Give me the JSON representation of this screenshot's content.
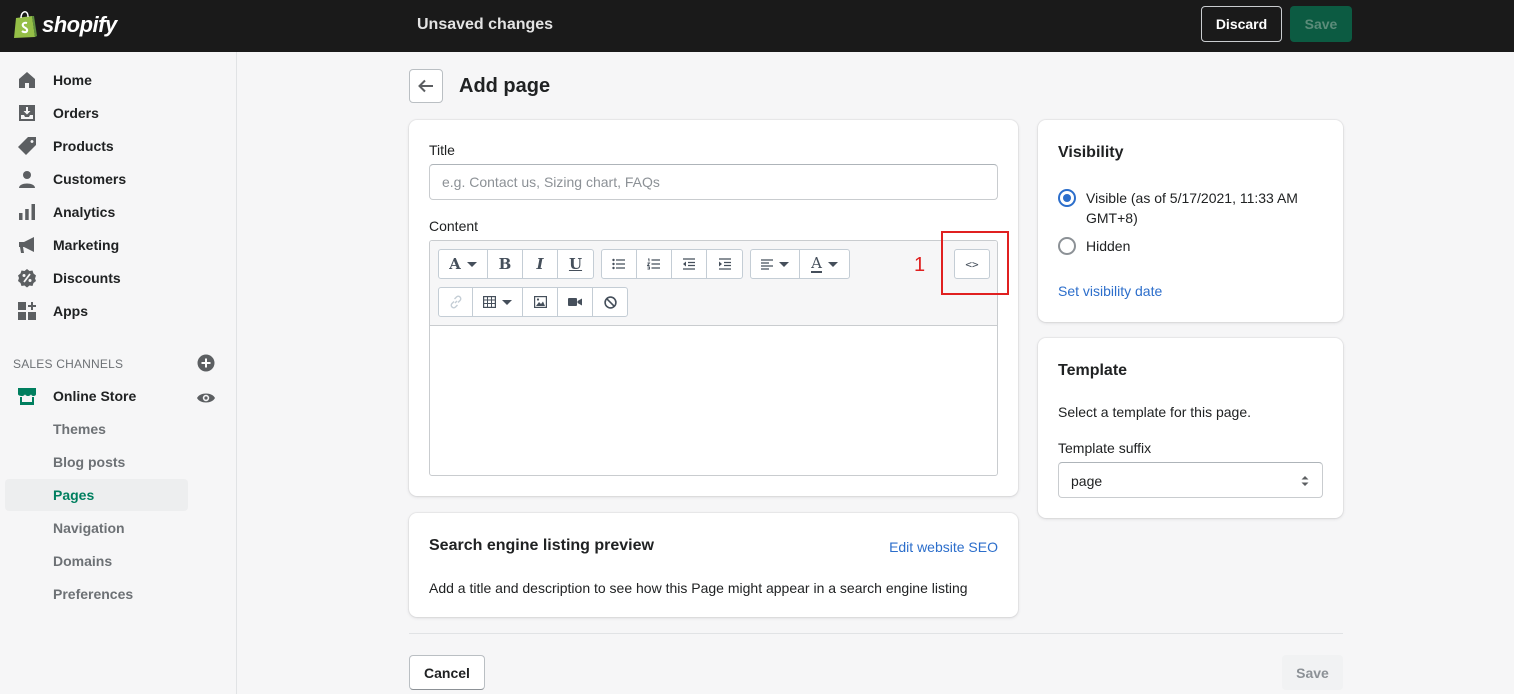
{
  "topbar": {
    "logo_text": "shopify",
    "status": "Unsaved changes",
    "discard_label": "Discard",
    "save_label": "Save"
  },
  "sidebar": {
    "items": [
      {
        "label": "Home",
        "icon": "home-icon"
      },
      {
        "label": "Orders",
        "icon": "orders-icon"
      },
      {
        "label": "Products",
        "icon": "tag-icon"
      },
      {
        "label": "Customers",
        "icon": "person-icon"
      },
      {
        "label": "Analytics",
        "icon": "bar-chart-icon"
      },
      {
        "label": "Marketing",
        "icon": "megaphone-icon"
      },
      {
        "label": "Discounts",
        "icon": "discount-icon"
      },
      {
        "label": "Apps",
        "icon": "apps-icon"
      }
    ],
    "sales_channels_title": "SALES CHANNELS",
    "online_store_label": "Online Store",
    "subitems": [
      {
        "label": "Themes"
      },
      {
        "label": "Blog posts"
      },
      {
        "label": "Pages",
        "active": true
      },
      {
        "label": "Navigation"
      },
      {
        "label": "Domains"
      },
      {
        "label": "Preferences"
      }
    ]
  },
  "header": {
    "title": "Add page"
  },
  "form": {
    "title_label": "Title",
    "title_placeholder": "e.g. Contact us, Sizing chart, FAQs",
    "content_label": "Content",
    "html_toggle_label": "<>",
    "annotation_number": "1"
  },
  "seo": {
    "title": "Search engine listing preview",
    "edit_link": "Edit website SEO",
    "description": "Add a title and description to see how this Page might appear in a search engine listing"
  },
  "visibility": {
    "title": "Visibility",
    "visible_label": "Visible (as of 5/17/2021, 11:33 AM",
    "visible_label_line2": "GMT+8)",
    "hidden_label": "Hidden",
    "set_date_link": "Set visibility date",
    "selected": "visible"
  },
  "template": {
    "title": "Template",
    "description": "Select a template for this page.",
    "suffix_label": "Template suffix",
    "suffix_value": "page"
  },
  "footer": {
    "cancel_label": "Cancel",
    "save_label": "Save"
  },
  "colors": {
    "accent_green": "#007f5f",
    "link_blue": "#2c6ecb",
    "annotation_red": "#e02020",
    "topbar": "#1a1a1a"
  }
}
